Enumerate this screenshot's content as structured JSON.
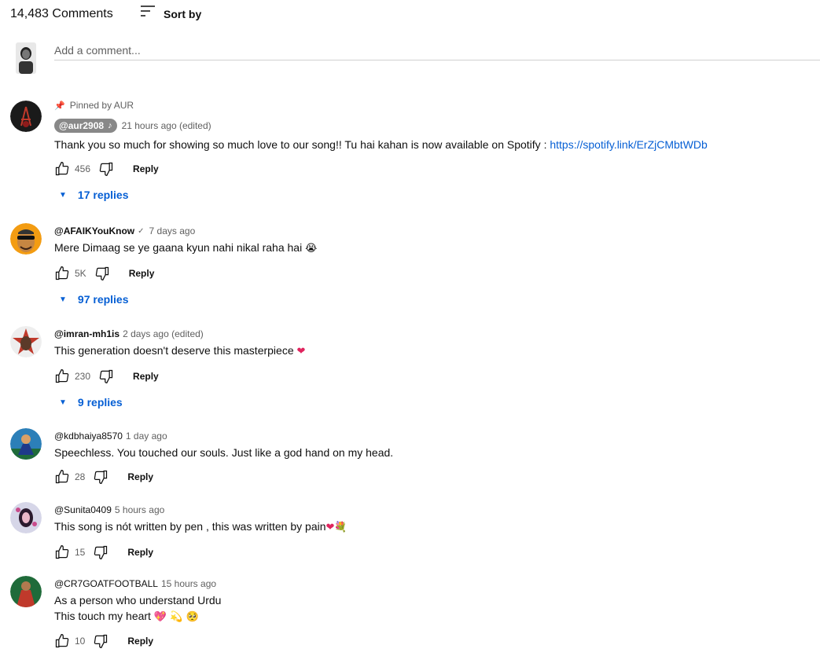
{
  "header": {
    "count": "14,483 Comments",
    "sort_label": "Sort by",
    "sort_icon": "sort-icon"
  },
  "add_comment": {
    "placeholder": "Add a comment..."
  },
  "comments": [
    {
      "pinned": "Pinned by AUR",
      "author": "@aur2908",
      "author_badge": true,
      "time": "21 hours ago (edited)",
      "text": "Thank you so much for showing so much love to our song!! Tu hai kahan is now available on Spotify : ",
      "link": "https://spotify.link/ErZjCMbtWDb",
      "likes": "456",
      "reply": "Reply",
      "replies": "17 replies"
    },
    {
      "author": "@AFAIKYouKnow",
      "verified": "✓",
      "time": "7 days ago",
      "text": "Mere Dimaag se ye gaana kyun nahi nikal raha hai",
      "emoji": "😭",
      "likes": "5K",
      "reply": "Reply",
      "replies": "97 replies"
    },
    {
      "author": "@imran-mh1is",
      "time": "2 days ago (edited)",
      "text": "This generation doesn't deserve this masterpiece",
      "emoji": "❤",
      "likes": "230",
      "reply": "Reply",
      "replies": "9 replies"
    },
    {
      "author": "@kdbhaiya8570",
      "time": "1 day ago",
      "text": "Speechless. You touched our souls. Just like a god hand on my head.",
      "likes": "28",
      "reply": "Reply"
    },
    {
      "author": "@Sunita0409",
      "time": "5 hours ago",
      "text": "This song is nót written by pen , this was written by pain",
      "emoji": "❤💐",
      "likes": "15",
      "reply": "Reply"
    },
    {
      "author": "@CR7GOATFOOTBALL",
      "time": "15 hours ago",
      "text": "As a person who understand Urdu",
      "text2": "This touch my heart",
      "emoji": "💖 💫 🥺",
      "likes": "10",
      "reply": "Reply"
    }
  ],
  "colors": {
    "link": "#065fd4",
    "secondary": "#606060",
    "heart": "#e0245e"
  }
}
